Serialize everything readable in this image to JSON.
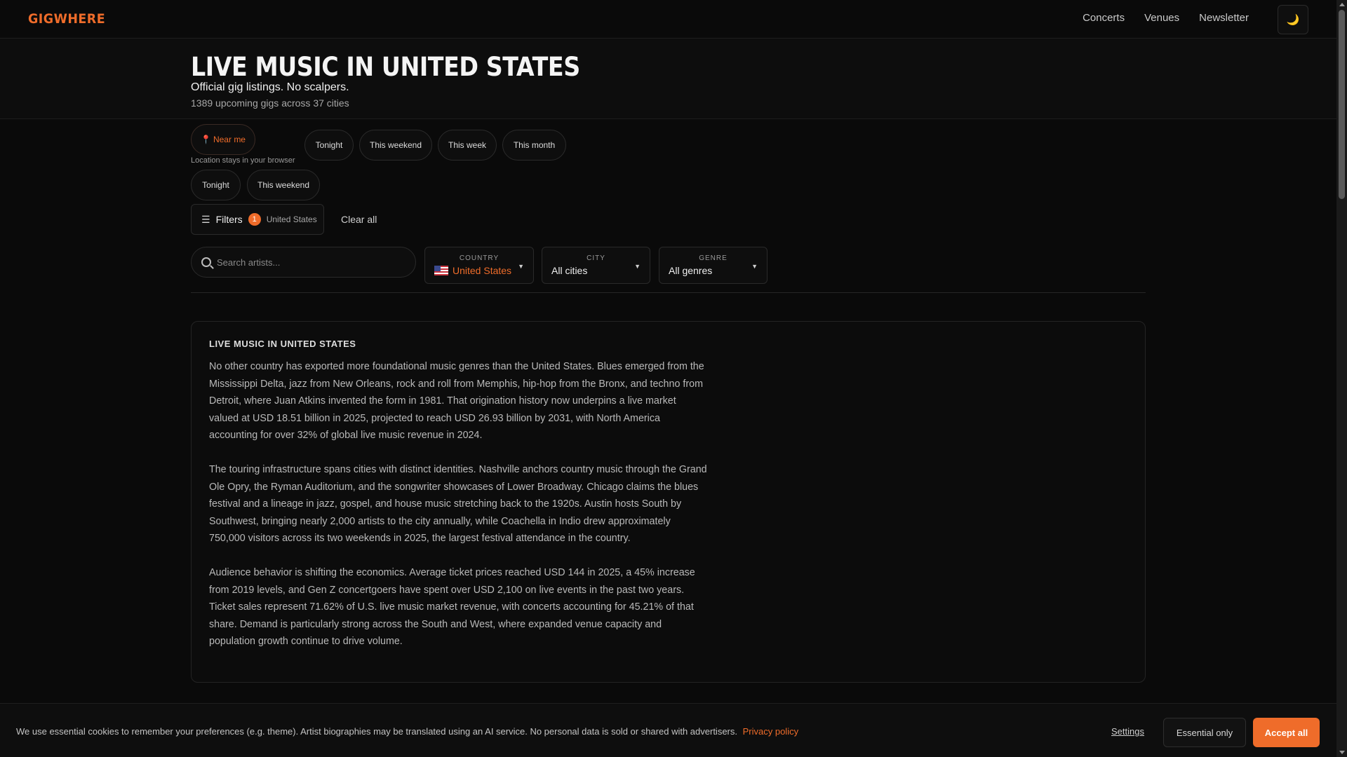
{
  "nav": {
    "logo": "GIGWHERE",
    "links": [
      "Concerts",
      "Venues",
      "Newsletter"
    ],
    "theme_icon": "moon-icon"
  },
  "hero": {
    "title": "LIVE MUSIC IN UNITED STATES",
    "subtitle": "Official gig listings. No scalpers.",
    "count": "1389 upcoming gigs across 37 cities"
  },
  "quick_filters": {
    "near_me": "Near me",
    "location_note": "Location stays in your browser",
    "row1": [
      "Tonight",
      "This weekend",
      "This week",
      "This month"
    ],
    "row2": [
      "Tonight",
      "This weekend"
    ]
  },
  "filters": {
    "label": "Filters",
    "badge_count": "1",
    "active_country": "United States",
    "clear_all": "Clear all"
  },
  "search": {
    "placeholder": "Search artists..."
  },
  "selects": {
    "country": {
      "label": "COUNTRY",
      "value": "United States"
    },
    "city": {
      "label": "CITY",
      "value": "All cities"
    },
    "genre": {
      "label": "GENRE",
      "value": "All genres"
    }
  },
  "article": {
    "title": "LIVE MUSIC IN UNITED STATES",
    "paragraphs": [
      "No other country has exported more foundational music genres than the United States. Blues emerged from the Mississippi Delta, jazz from New Orleans, rock and roll from Memphis, hip-hop from the Bronx, and techno from Detroit, where Juan Atkins invented the form in 1981. That origination history now underpins a live market valued at USD 18.51 billion in 2025, projected to reach USD 26.93 billion by 2031, with North America accounting for over 32% of global live music revenue in 2024.",
      "The touring infrastructure spans cities with distinct identities. Nashville anchors country music through the Grand Ole Opry, the Ryman Auditorium, and the songwriter showcases of Lower Broadway. Chicago claims the blues festival and a lineage in jazz, gospel, and house music stretching back to the 1920s. Austin hosts South by Southwest, bringing nearly 2,000 artists to the city annually, while Coachella in Indio drew approximately 750,000 visitors across its two weekends in 2025, the largest festival attendance in the country.",
      "Audience behavior is shifting the economics. Average ticket prices reached USD 144 in 2025, a 45% increase from 2019 levels, and Gen Z concertgoers have spent over USD 2,100 on live events in the past two years. Ticket sales represent 71.62% of U.S. live music market revenue, with concerts accounting for 45.21% of that share. Demand is particularly strong across the South and West, where expanded venue capacity and population growth continue to drive volume."
    ]
  },
  "cookie": {
    "text": "We use essential cookies to remember your preferences (e.g. theme). Artist biographies may be translated using an AI service. No personal data is sold or shared with advertisers.",
    "privacy_link": "Privacy policy",
    "settings": "Settings",
    "essential_only": "Essential only",
    "accept_all": "Accept all"
  },
  "colors": {
    "accent": "#ef6c2a",
    "background": "#0a0a0a"
  }
}
